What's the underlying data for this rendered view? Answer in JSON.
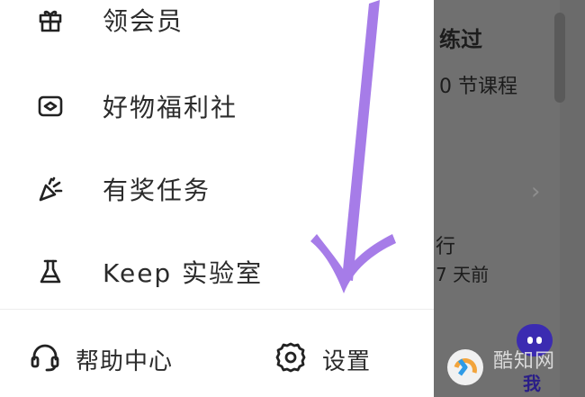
{
  "menu": {
    "items": [
      {
        "label": "领会员",
        "icon": "gift-icon"
      },
      {
        "label": "好物福利社",
        "icon": "shop-box-icon"
      },
      {
        "label": "有奖任务",
        "icon": "party-popper-icon"
      },
      {
        "label": "Keep 实验室",
        "icon": "flask-icon"
      }
    ]
  },
  "footer": {
    "help_label": "帮助中心",
    "help_icon": "headset-icon",
    "settings_label": "设置",
    "settings_icon": "gear-icon"
  },
  "background": {
    "trained_title": "练过",
    "course_count": "0 节课程",
    "item_fragment": "行",
    "time_ago": "7 天前",
    "tab_me": "我"
  },
  "watermark": {
    "text": "酷知网"
  },
  "colors": {
    "arrow": "#a67ce8",
    "drawer_bg": "#ffffff",
    "overlay": "#6b6b6b",
    "brand_badge": "#3b2bb1"
  }
}
